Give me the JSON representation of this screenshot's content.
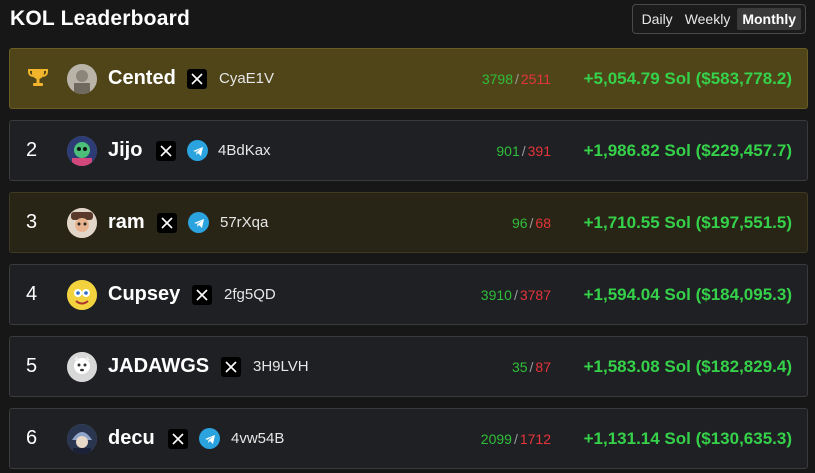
{
  "title": "KOL Leaderboard",
  "tabs": [
    {
      "label": "Daily",
      "active": false
    },
    {
      "label": "Weekly",
      "active": false
    },
    {
      "label": "Monthly",
      "active": true
    }
  ],
  "colors": {
    "buys": "#2fbf3a",
    "sells": "#e5343a",
    "pnl": "#35d14a",
    "first_place_bg": "#4f4519"
  },
  "rows": [
    {
      "rank": "",
      "rank_icon": "trophy-icon",
      "name": "Cented",
      "socials": [
        "x"
      ],
      "wallet": "CyaE1V",
      "buys": "3798",
      "sells": "2511",
      "pnl": "+5,054.79 Sol ($583,778.2)"
    },
    {
      "rank": "2",
      "name": "Jijo",
      "socials": [
        "x",
        "telegram"
      ],
      "wallet": "4BdKax",
      "buys": "901",
      "sells": "391",
      "pnl": "+1,986.82 Sol ($229,457.7)"
    },
    {
      "rank": "3",
      "name": "ram",
      "socials": [
        "x",
        "telegram"
      ],
      "wallet": "57rXqa",
      "buys": "96",
      "sells": "68",
      "pnl": "+1,710.55 Sol ($197,551.5)"
    },
    {
      "rank": "4",
      "name": "Cupsey",
      "socials": [
        "x"
      ],
      "wallet": "2fg5QD",
      "buys": "3910",
      "sells": "3787",
      "pnl": "+1,594.04 Sol ($184,095.3)"
    },
    {
      "rank": "5",
      "name": "JADAWGS",
      "socials": [
        "x"
      ],
      "wallet": "3H9LVH",
      "buys": "35",
      "sells": "87",
      "pnl": "+1,583.08 Sol ($182,829.4)"
    },
    {
      "rank": "6",
      "name": "decu",
      "socials": [
        "x",
        "telegram"
      ],
      "wallet": "4vw54B",
      "buys": "2099",
      "sells": "1712",
      "pnl": "+1,131.14 Sol ($130,635.3)"
    }
  ]
}
